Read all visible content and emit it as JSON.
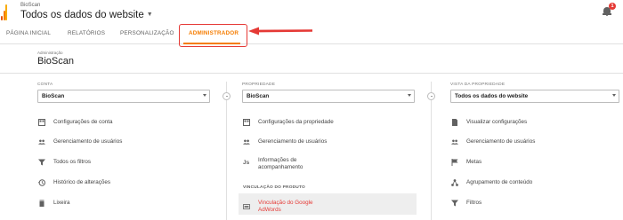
{
  "header": {
    "account_name": "BioScan",
    "view_name": "Todos os dados do website",
    "notification_count": "1"
  },
  "tabs": [
    {
      "label": "PÁGINA INICIAL"
    },
    {
      "label": "RELATÓRIOS"
    },
    {
      "label": "PERSONALIZAÇÃO"
    },
    {
      "label": "ADMINISTRADOR"
    }
  ],
  "admin": {
    "small_label": "Administração",
    "title": "BioScan"
  },
  "columns": {
    "account": {
      "label": "CONTA",
      "selected": "BioScan",
      "items": [
        {
          "label": "Configurações de conta",
          "icon": "grid-icon"
        },
        {
          "label": "Gerenciamento de usuários",
          "icon": "users-icon"
        },
        {
          "label": "Todos os filtros",
          "icon": "filter-icon"
        },
        {
          "label": "Histórico de alterações",
          "icon": "history-icon"
        },
        {
          "label": "Lixeira",
          "icon": "trash-icon"
        }
      ]
    },
    "property": {
      "label": "PROPRIEDADE",
      "selected": "BioScan",
      "items": [
        {
          "label": "Configurações da propriedade",
          "icon": "grid-icon"
        },
        {
          "label": "Gerenciamento de usuários",
          "icon": "users-icon"
        },
        {
          "label_line1": "Informações de",
          "label_line2": "acompanhamento",
          "icon": "js-icon"
        }
      ],
      "section_header": "VINCULAÇÃO DO PRODUTO",
      "link_item": {
        "label_line1": "Vinculação do Google",
        "label_line2": "AdWords",
        "icon": "adwords-icon"
      }
    },
    "view": {
      "label": "VISTA DA PROPRIEDADE",
      "selected": "Todos os dados do website",
      "items": [
        {
          "label": "Visualizar configurações",
          "icon": "doc-icon"
        },
        {
          "label": "Gerenciamento de usuários",
          "icon": "users-icon"
        },
        {
          "label": "Metas",
          "icon": "flag-icon"
        },
        {
          "label": "Agrupamento de conteúdo",
          "icon": "content-icon"
        },
        {
          "label": "Filtros",
          "icon": "filter-icon"
        }
      ]
    }
  },
  "colors": {
    "accent": "#f57c00",
    "highlight_red": "#e53935"
  }
}
